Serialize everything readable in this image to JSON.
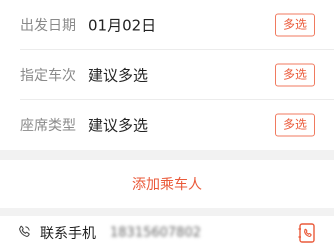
{
  "rows": [
    {
      "label": "出发日期",
      "value": "01月02日",
      "button": "多选"
    },
    {
      "label": "指定车次",
      "value": "建议多选",
      "button": "多选"
    },
    {
      "label": "座席类型",
      "value": "建议多选",
      "button": "多选"
    }
  ],
  "add_passenger": {
    "label": "添加乘车人"
  },
  "contact": {
    "label": "联系手机",
    "phone": "18315607802",
    "icon": "phone-icon",
    "action_icon": "contacts-book-icon"
  },
  "colors": {
    "accent": "#ea5a3a",
    "label_gray": "#8a8a8a",
    "background": "#f2f2f2"
  }
}
